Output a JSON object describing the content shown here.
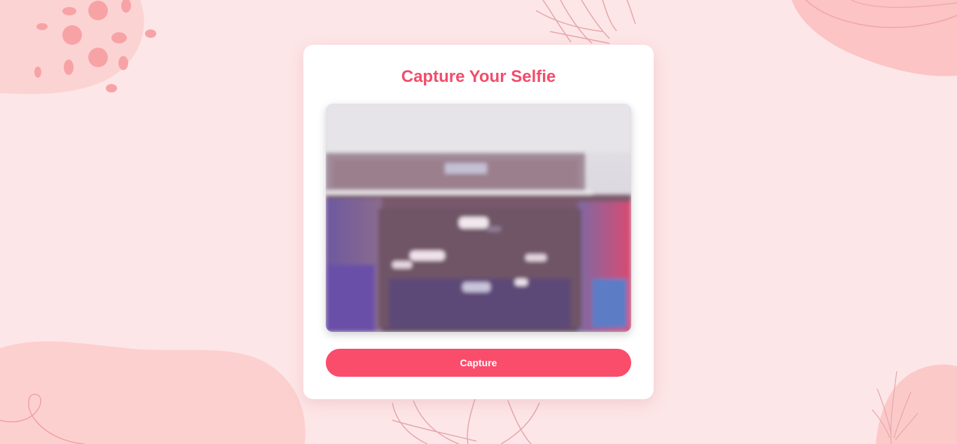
{
  "page": {
    "title": "Capture Your Selfie"
  },
  "camera": {
    "feed_state": "live-preview"
  },
  "actions": {
    "capture_label": "Capture"
  },
  "theme": {
    "background": "#fde6e7",
    "accent": "#f24d6b",
    "button": "#fa4d6b",
    "decor_pink": "#fbcaca",
    "decor_dots": "#f7a3a6",
    "leaf_stroke": "#e5a7ab"
  }
}
